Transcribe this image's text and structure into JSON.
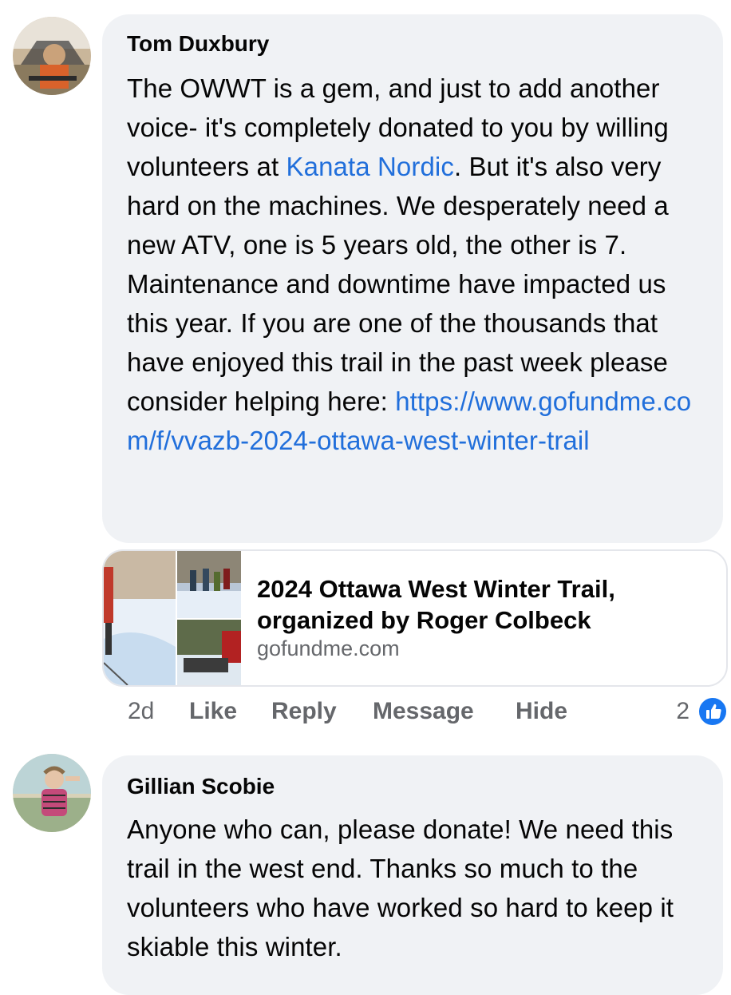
{
  "comments": [
    {
      "author": "Tom Duxbury",
      "text_before_link": "The OWWT is a gem, and just to add another voice- it's completely donated to you by willing volunteers at ",
      "mention": "Kanata Nordic",
      "text_after_mention": ". But it's also very hard on the machines. We desperately need a new ATV, one is 5 years old, the other is 7.  Maintenance and downtime have impacted us this year.   If you are one of the thousands that have enjoyed this trail in the past week please consider helping here: ",
      "url": "https://www.gofundme.com/f/vvazb-2024-ottawa-west-winter-trail",
      "link_preview": {
        "title": "2024 Ottawa West Winter Trail, organized by Roger Colbeck",
        "domain": "gofundme.com"
      },
      "actions": {
        "time": "2d",
        "like": "Like",
        "reply": "Reply",
        "message": "Message",
        "hide": "Hide",
        "reaction_count": "2"
      }
    },
    {
      "author": "Gillian Scobie",
      "text": "Anyone who can, please donate! We need this trail in the west end. Thanks so much to the volunteers who have worked so hard to keep it skiable this winter."
    }
  ],
  "colors": {
    "bubble": "#f0f2f5",
    "link": "#216fdb",
    "secondary_text": "#65676b",
    "like_badge": "#1877f2"
  }
}
